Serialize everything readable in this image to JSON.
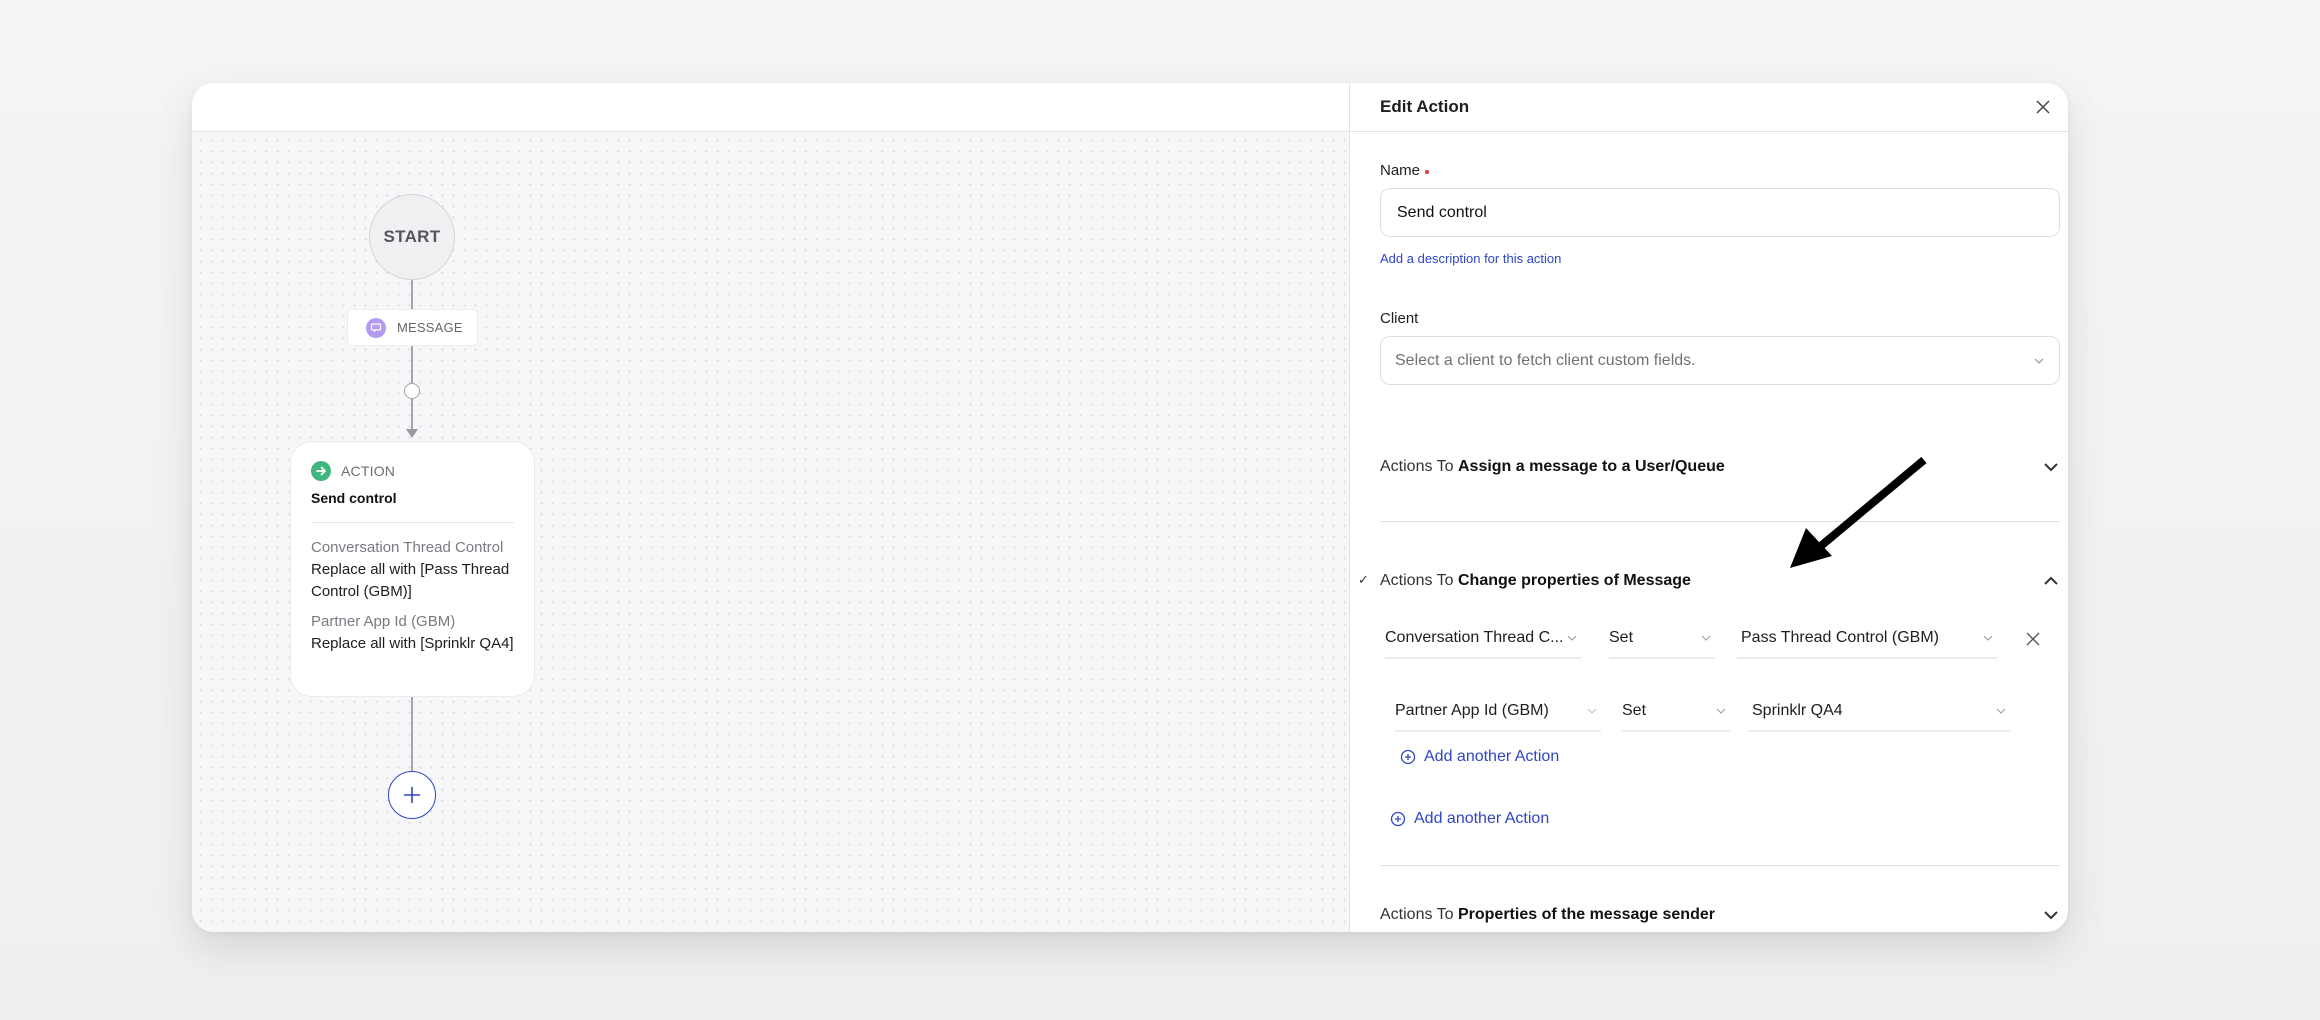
{
  "canvas": {
    "start_label": "START",
    "message_node": {
      "icon": "chat-bubble-icon",
      "label": "MESSAGE",
      "icon_color": "#b39af0"
    },
    "action_node": {
      "icon": "arrow-right-circle-icon",
      "icon_color": "#3fb67e",
      "type_label": "ACTION",
      "name": "Send control",
      "properties": [
        {
          "label": "Conversation Thread Control",
          "value": "Replace all with [Pass Thread Control (GBM)]"
        },
        {
          "label": "Partner App Id (GBM)",
          "value": "Replace all with [Sprinklr QA4]"
        }
      ]
    },
    "add_node_icon": "plus-icon"
  },
  "panel": {
    "title": "Edit Action",
    "close_icon": "close-icon",
    "name_field": {
      "label": "Name",
      "required": true,
      "value": "Send control"
    },
    "description_link": "Add a description for this action",
    "client_field": {
      "label": "Client",
      "placeholder": "Select a client to fetch client custom fields."
    },
    "sections": [
      {
        "prefix": "Actions To",
        "title": "Assign a message to a User/Queue",
        "expanded": false,
        "checked": false
      },
      {
        "prefix": "Actions To",
        "title": "Change properties of Message",
        "expanded": true,
        "checked": true,
        "rules": [
          {
            "field": "Conversation Thread C...",
            "operator": "Set",
            "value": "Pass Thread Control (GBM)"
          },
          {
            "field": "Partner App Id (GBM)",
            "operator": "Set",
            "value": "Sprinklr QA4"
          }
        ],
        "inner_add_label": "Add another Action",
        "outer_add_label": "Add another Action"
      },
      {
        "prefix": "Actions To",
        "title": "Properties of the message sender",
        "expanded": false,
        "checked": false
      }
    ]
  },
  "colors": {
    "accent": "#2f45c5",
    "required": "#e03a3a"
  }
}
